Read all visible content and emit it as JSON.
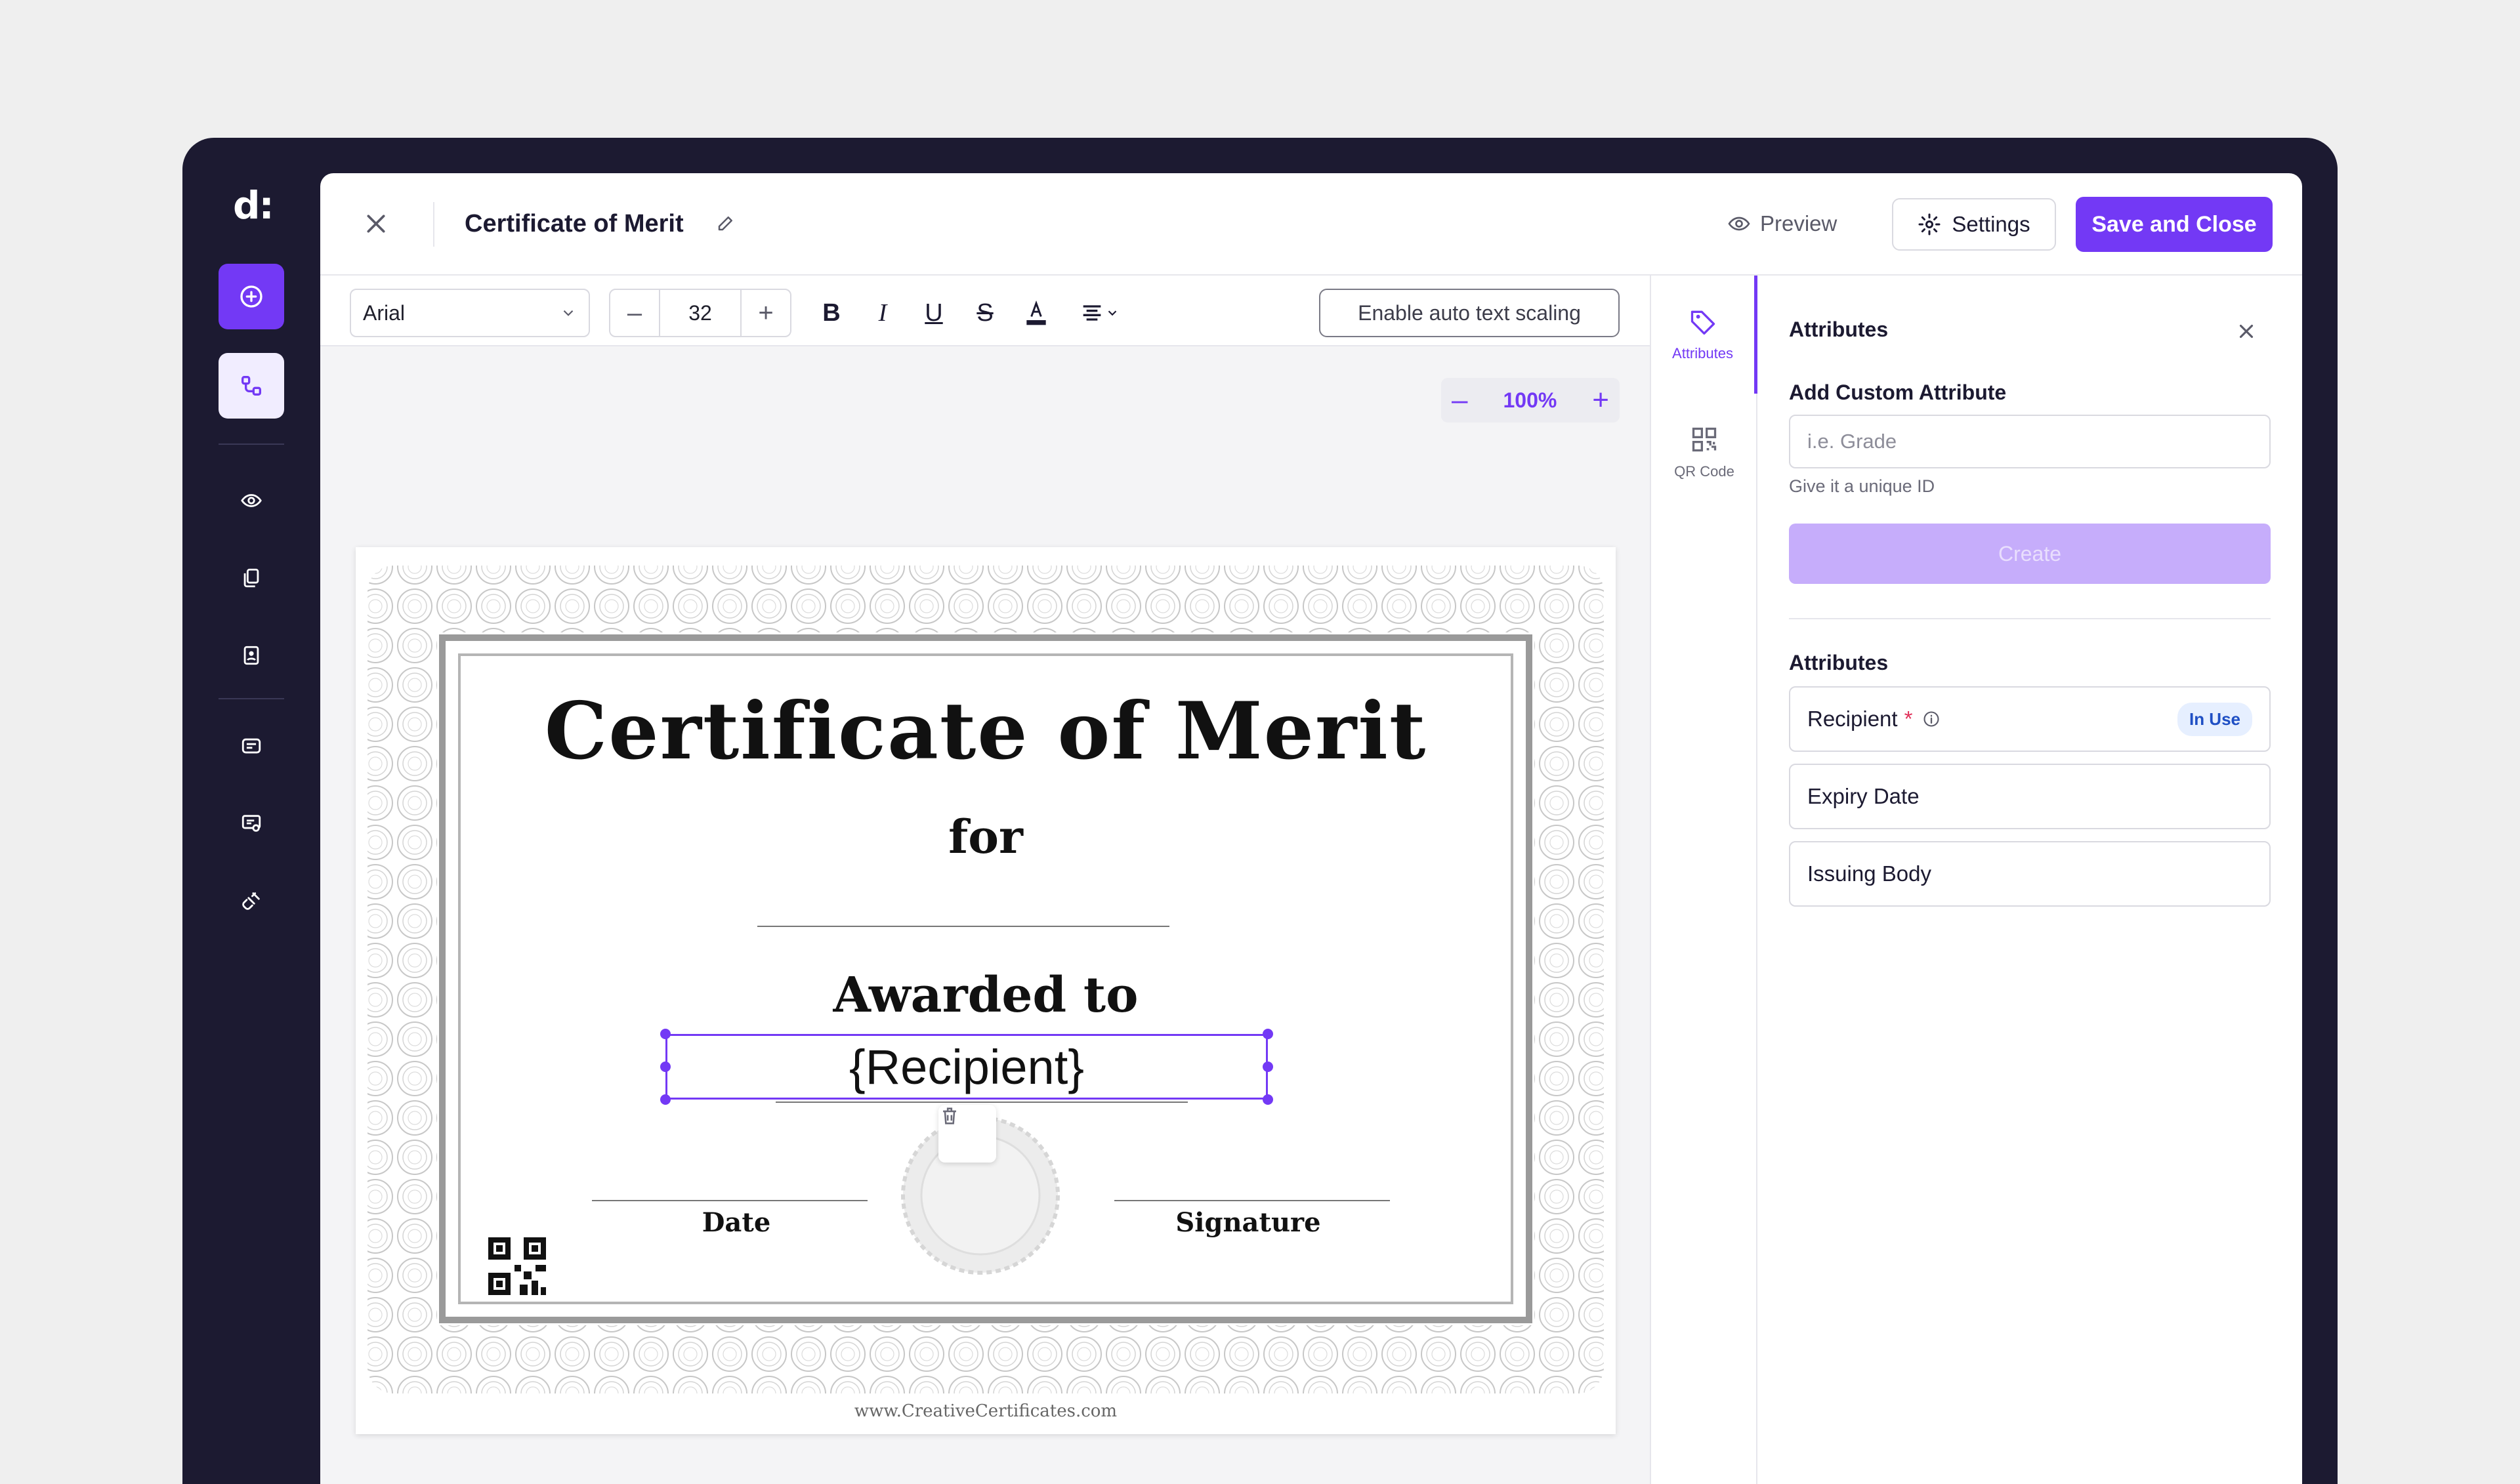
{
  "header": {
    "title": "Certificate of Merit",
    "preview_label": "Preview",
    "settings_label": "Settings",
    "save_label": "Save and Close"
  },
  "toolbar": {
    "font": "Arial",
    "font_size": "32",
    "auto_scale_label": "Enable auto text scaling"
  },
  "zoom": {
    "level": "100%"
  },
  "certificate": {
    "title": "Certificate of Merit",
    "for": "for",
    "awarded": "Awarded to",
    "recipient_placeholder": "{Recipient}",
    "date_label": "Date",
    "signature_label": "Signature",
    "url": "www.CreativeCertificates.com"
  },
  "side_tabs": [
    {
      "label": "Attributes",
      "icon": "tag-icon"
    },
    {
      "label": "QR Code",
      "icon": "qr-code-icon"
    }
  ],
  "panel": {
    "title": "Attributes",
    "add_heading": "Add Custom Attribute",
    "input_placeholder": "i.e. Grade",
    "hint": "Give it a unique ID",
    "create_label": "Create",
    "list_heading": "Attributes",
    "attributes": [
      {
        "name": "Recipient",
        "required": "*",
        "badge": "In Use"
      },
      {
        "name": "Expiry Date"
      },
      {
        "name": "Issuing Body"
      }
    ]
  },
  "colors": {
    "accent": "#7339f5",
    "rail": "#1c1a31",
    "badge_bg": "#e6efff",
    "badge_text": "#1f4fc4"
  }
}
